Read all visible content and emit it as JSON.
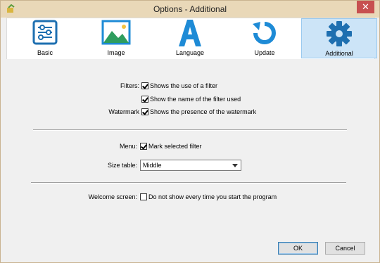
{
  "window": {
    "title": "Options - Additional",
    "close_glyph": "✕"
  },
  "tabs": [
    {
      "label": "Basic",
      "icon": "sliders-icon"
    },
    {
      "label": "Image",
      "icon": "image-icon"
    },
    {
      "label": "Language",
      "icon": "letter-a-icon"
    },
    {
      "label": "Update",
      "icon": "refresh-icon"
    },
    {
      "label": "Additional",
      "icon": "gear-icon",
      "selected": true
    }
  ],
  "settings": {
    "filters_label": "Filters:",
    "filter_use": {
      "label": "Shows the use of a filter",
      "checked": true
    },
    "filter_name": {
      "label": "Show the name of the filter used",
      "checked": true
    },
    "watermark_label": "Watermark",
    "watermark": {
      "label": "Shows the presence of the watermark",
      "checked": true
    },
    "menu_label": "Menu:",
    "mark_selected": {
      "label": "Mark selected filter",
      "checked": true
    },
    "size_table_label": "Size table:",
    "size_table_value": "Middle",
    "welcome_label": "Welcome screen:",
    "welcome": {
      "label": "Do not show every time you start the program",
      "checked": false
    }
  },
  "buttons": {
    "ok": "OK",
    "cancel": "Cancel"
  },
  "colors": {
    "accent": "#1e8bd6",
    "image_green": "#2e9d5e",
    "selected_tab": "#cce4f7"
  }
}
